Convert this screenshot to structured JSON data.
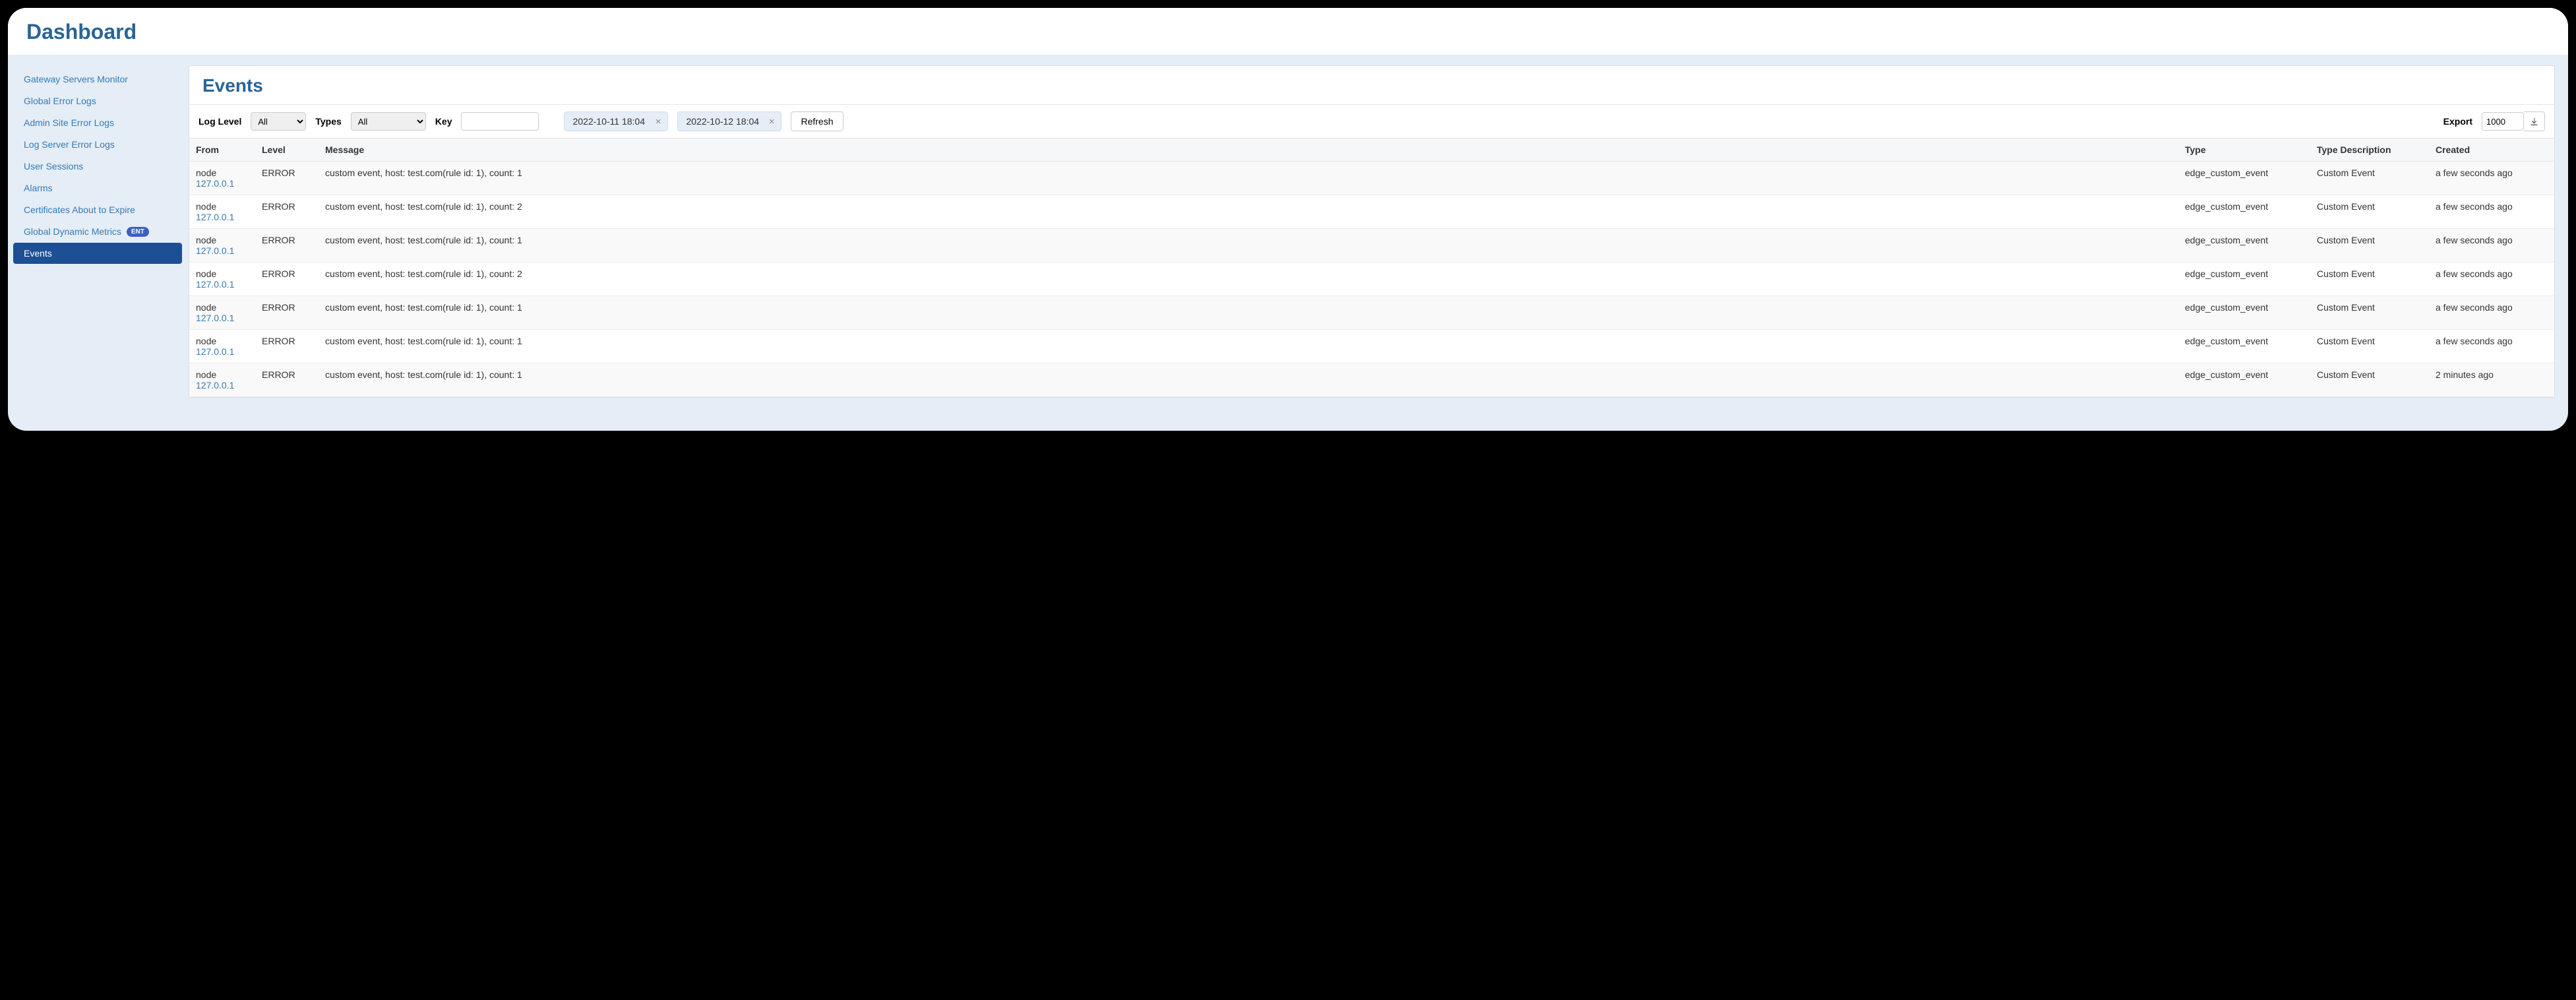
{
  "header": {
    "title": "Dashboard"
  },
  "sidebar": {
    "items": [
      {
        "label": "Gateway Servers Monitor",
        "active": false
      },
      {
        "label": "Global Error Logs",
        "active": false
      },
      {
        "label": "Admin Site Error Logs",
        "active": false
      },
      {
        "label": "Log Server Error Logs",
        "active": false
      },
      {
        "label": "User Sessions",
        "active": false
      },
      {
        "label": "Alarms",
        "active": false
      },
      {
        "label": "Certificates About to Expire",
        "active": false
      },
      {
        "label": "Global Dynamic Metrics",
        "active": false,
        "badge": "ENT"
      },
      {
        "label": "Events",
        "active": true
      }
    ]
  },
  "page": {
    "title": "Events"
  },
  "filters": {
    "log_level_label": "Log Level",
    "log_level_value": "All",
    "types_label": "Types",
    "types_value": "All",
    "key_label": "Key",
    "key_value": "",
    "date_from": "2022-10-11 18:04",
    "date_to": "2022-10-12 18:04",
    "refresh_label": "Refresh",
    "export_label": "Export",
    "export_value": "1000"
  },
  "table": {
    "columns": [
      "From",
      "Level",
      "Message",
      "Type",
      "Type Description",
      "Created"
    ],
    "rows": [
      {
        "from_node": "node",
        "from_ip": "127.0.0.1",
        "level": "ERROR",
        "message": "custom event, host: test.com(rule id: 1), count: 1",
        "type": "edge_custom_event",
        "type_desc": "Custom Event",
        "created": "a few seconds ago"
      },
      {
        "from_node": "node",
        "from_ip": "127.0.0.1",
        "level": "ERROR",
        "message": "custom event, host: test.com(rule id: 1), count: 2",
        "type": "edge_custom_event",
        "type_desc": "Custom Event",
        "created": "a few seconds ago"
      },
      {
        "from_node": "node",
        "from_ip": "127.0.0.1",
        "level": "ERROR",
        "message": "custom event, host: test.com(rule id: 1), count: 1",
        "type": "edge_custom_event",
        "type_desc": "Custom Event",
        "created": "a few seconds ago"
      },
      {
        "from_node": "node",
        "from_ip": "127.0.0.1",
        "level": "ERROR",
        "message": "custom event, host: test.com(rule id: 1), count: 2",
        "type": "edge_custom_event",
        "type_desc": "Custom Event",
        "created": "a few seconds ago"
      },
      {
        "from_node": "node",
        "from_ip": "127.0.0.1",
        "level": "ERROR",
        "message": "custom event, host: test.com(rule id: 1), count: 1",
        "type": "edge_custom_event",
        "type_desc": "Custom Event",
        "created": "a few seconds ago"
      },
      {
        "from_node": "node",
        "from_ip": "127.0.0.1",
        "level": "ERROR",
        "message": "custom event, host: test.com(rule id: 1), count: 1",
        "type": "edge_custom_event",
        "type_desc": "Custom Event",
        "created": "a few seconds ago"
      },
      {
        "from_node": "node",
        "from_ip": "127.0.0.1",
        "level": "ERROR",
        "message": "custom event, host: test.com(rule id: 1), count: 1",
        "type": "edge_custom_event",
        "type_desc": "Custom Event",
        "created": "2 minutes ago"
      }
    ]
  }
}
